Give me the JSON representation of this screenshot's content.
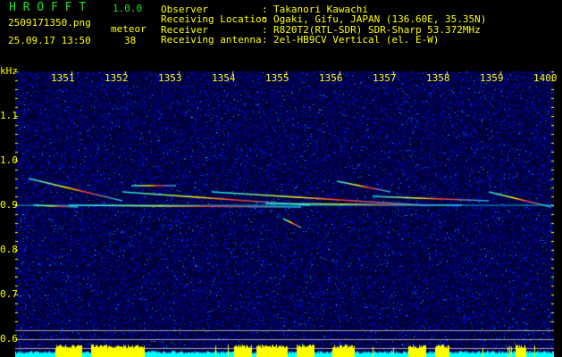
{
  "app": {
    "name": "H R O F F T",
    "version": "1.0.0"
  },
  "file": {
    "name": "2509171350.png",
    "datetime": "25.09.17 13:50"
  },
  "meteor": {
    "label": "meteor",
    "count": "38"
  },
  "info": [
    {
      "label": "Observer",
      "sep": ":",
      "value": "Takanori Kawachi"
    },
    {
      "label": "Receiving Location",
      "sep": ":",
      "value": "Ogaki, Gifu, JAPAN (136.60E, 35.35N)"
    },
    {
      "label": "Receiver",
      "sep": ":",
      "value": "R820T2(RTL-SDR) SDR-Sharp 53.372MHz"
    },
    {
      "label": "Receiving antenna",
      "sep": ":",
      "value": "2el-HB9CV Vertical (el. E-W)"
    }
  ],
  "axis": {
    "y_unit": "kHz",
    "x_ticks": [
      "1351",
      "1352",
      "1353",
      "1354",
      "1355",
      "1356",
      "1357",
      "1358",
      "1359",
      "1400"
    ],
    "y_ticks": [
      "1.1",
      "1.0",
      "0.9",
      "0.8",
      "0.7",
      "0.6"
    ]
  },
  "colors": {
    "text": "#ffff00",
    "logo": "#22e022",
    "noise": "#0000a0",
    "level_high": "#ffff00",
    "level_low": "#00ffff"
  }
}
